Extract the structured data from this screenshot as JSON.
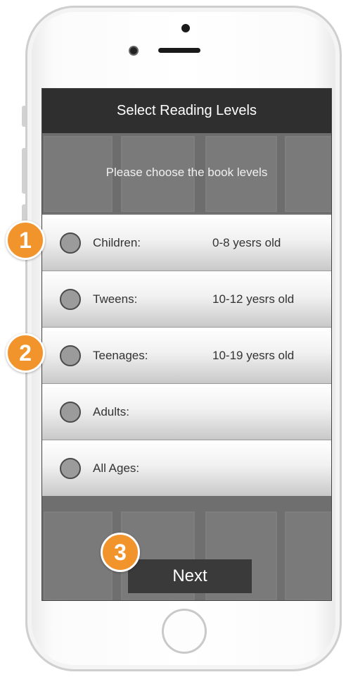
{
  "header": {
    "title": "Select Reading Levels"
  },
  "banner": {
    "prompt": "Please choose the book levels"
  },
  "options": [
    {
      "label": "Children:",
      "age": "0-8 yesrs old"
    },
    {
      "label": "Tweens:",
      "age": "10-12 yesrs old"
    },
    {
      "label": "Teenages:",
      "age": "10-19 yesrs old"
    },
    {
      "label": "Adults:",
      "age": ""
    },
    {
      "label": "All Ages:",
      "age": ""
    }
  ],
  "actions": {
    "next_label": "Next"
  },
  "badges": [
    "1",
    "2",
    "3"
  ],
  "colors": {
    "nav_bar": "#2f2f2f",
    "badge": "#f2942c",
    "next_button": "#3a3a3a"
  }
}
